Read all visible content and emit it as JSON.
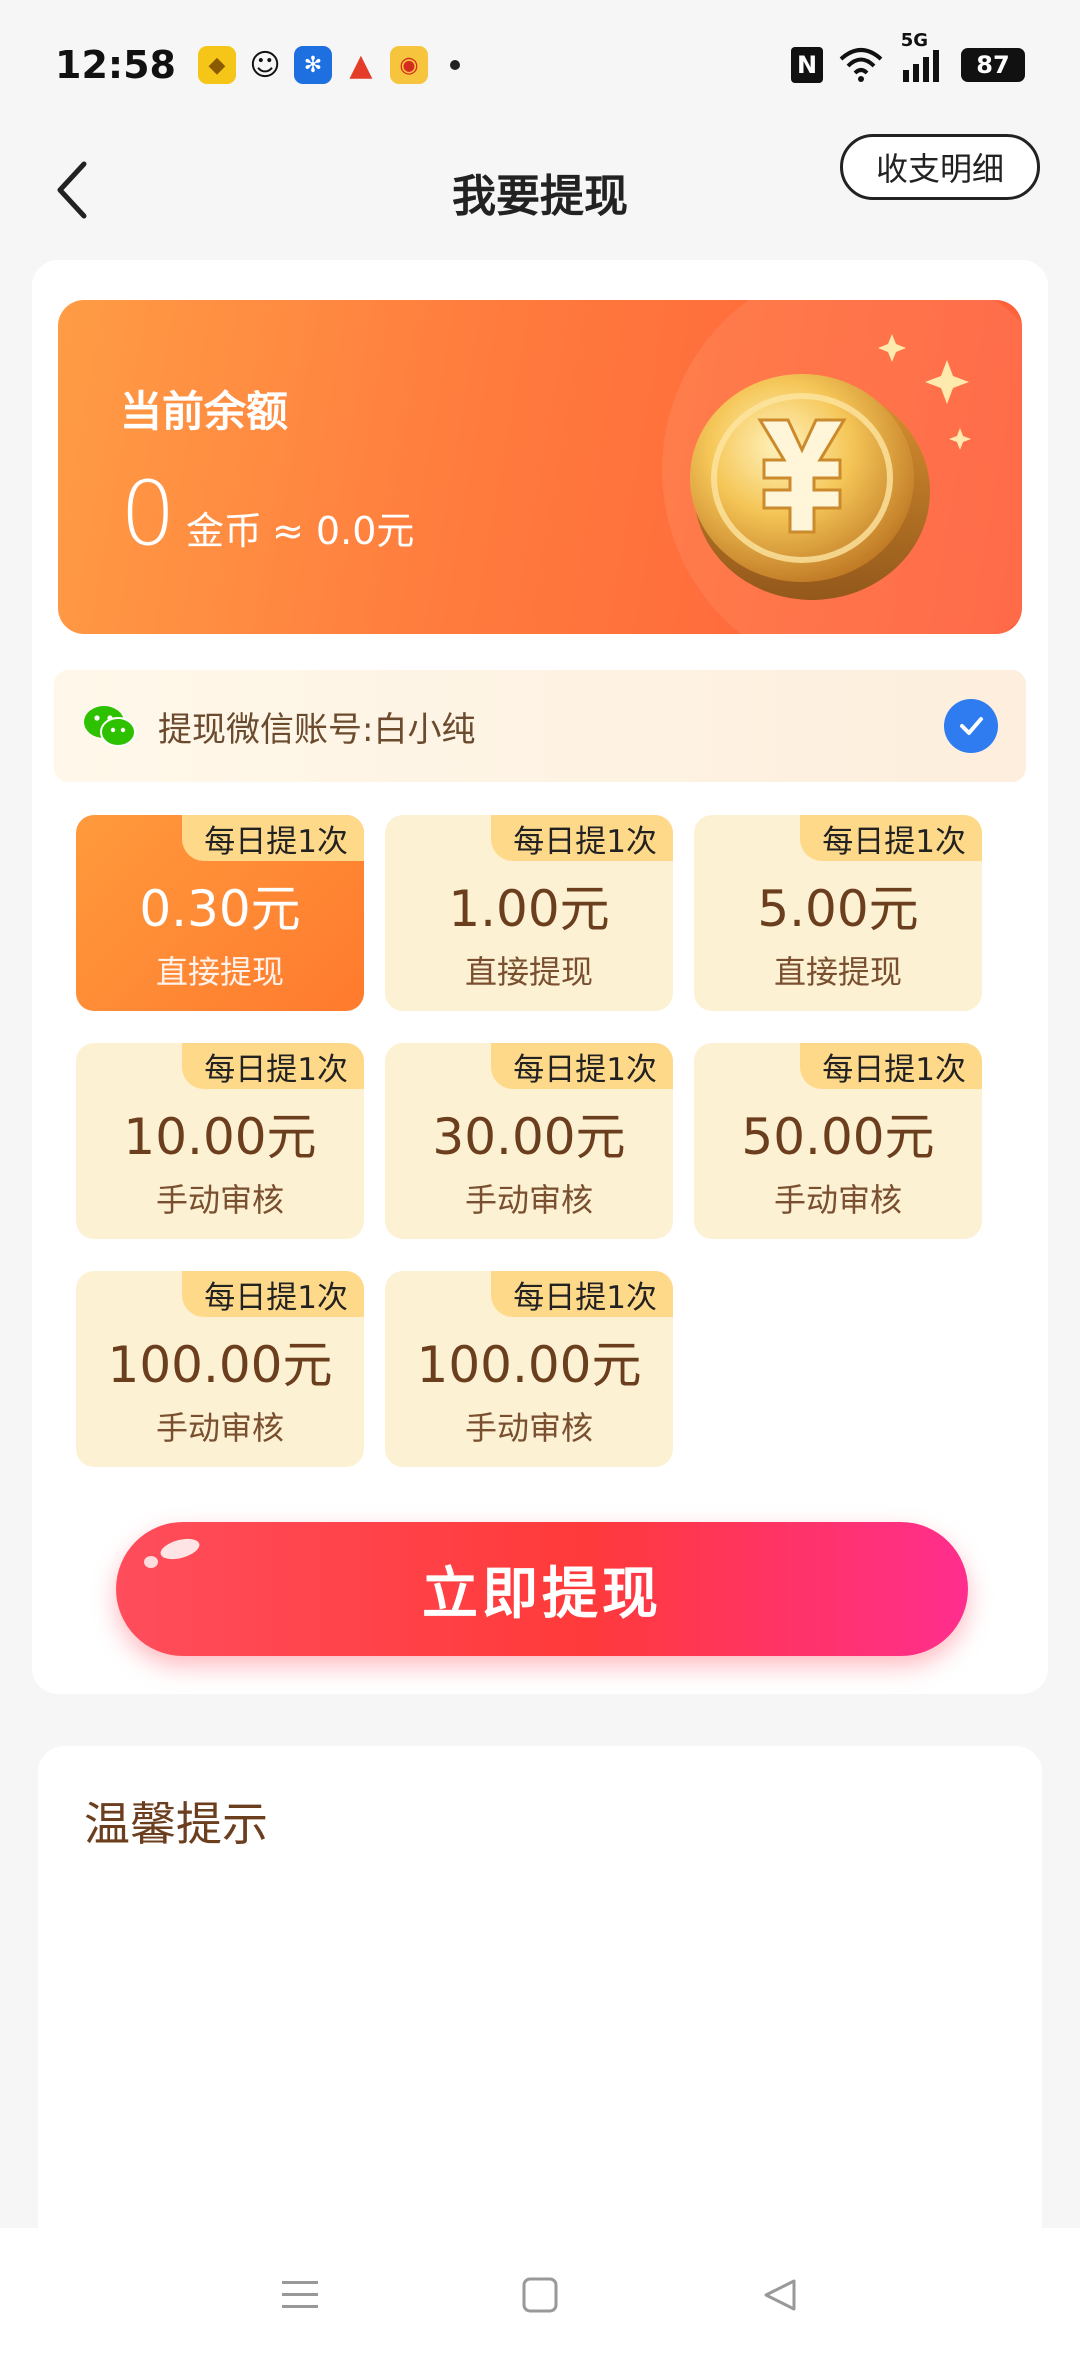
{
  "status_bar": {
    "time": "12:58",
    "battery": "87",
    "signal_label": "5G"
  },
  "header": {
    "title": "我要提现",
    "detail_button": "收支明细"
  },
  "balance": {
    "label": "当前余额",
    "amount": "0",
    "unit": "金币",
    "approx": "≈ 0.0元"
  },
  "wechat": {
    "label": "提现微信账号:白小纯"
  },
  "options": [
    {
      "badge": "每日提1次",
      "amount": "0.30元",
      "type": "直接提现",
      "selected": true
    },
    {
      "badge": "每日提1次",
      "amount": "1.00元",
      "type": "直接提现",
      "selected": false
    },
    {
      "badge": "每日提1次",
      "amount": "5.00元",
      "type": "直接提现",
      "selected": false
    },
    {
      "badge": "每日提1次",
      "amount": "10.00元",
      "type": "手动审核",
      "selected": false
    },
    {
      "badge": "每日提1次",
      "amount": "30.00元",
      "type": "手动审核",
      "selected": false
    },
    {
      "badge": "每日提1次",
      "amount": "50.00元",
      "type": "手动审核",
      "selected": false
    },
    {
      "badge": "每日提1次",
      "amount": "100.00元",
      "type": "手动审核",
      "selected": false
    },
    {
      "badge": "每日提1次",
      "amount": "100.00元",
      "type": "手动审核",
      "selected": false
    }
  ],
  "withdraw_button": "立即提现",
  "tips": {
    "title": "温馨提示"
  },
  "colors": {
    "accent": "#ff7a2e",
    "button": "#ff3a3a",
    "tile_bg": "#fdf1d4",
    "badge_bg": "#ffd98a",
    "text_brown": "#6b3e1e"
  }
}
